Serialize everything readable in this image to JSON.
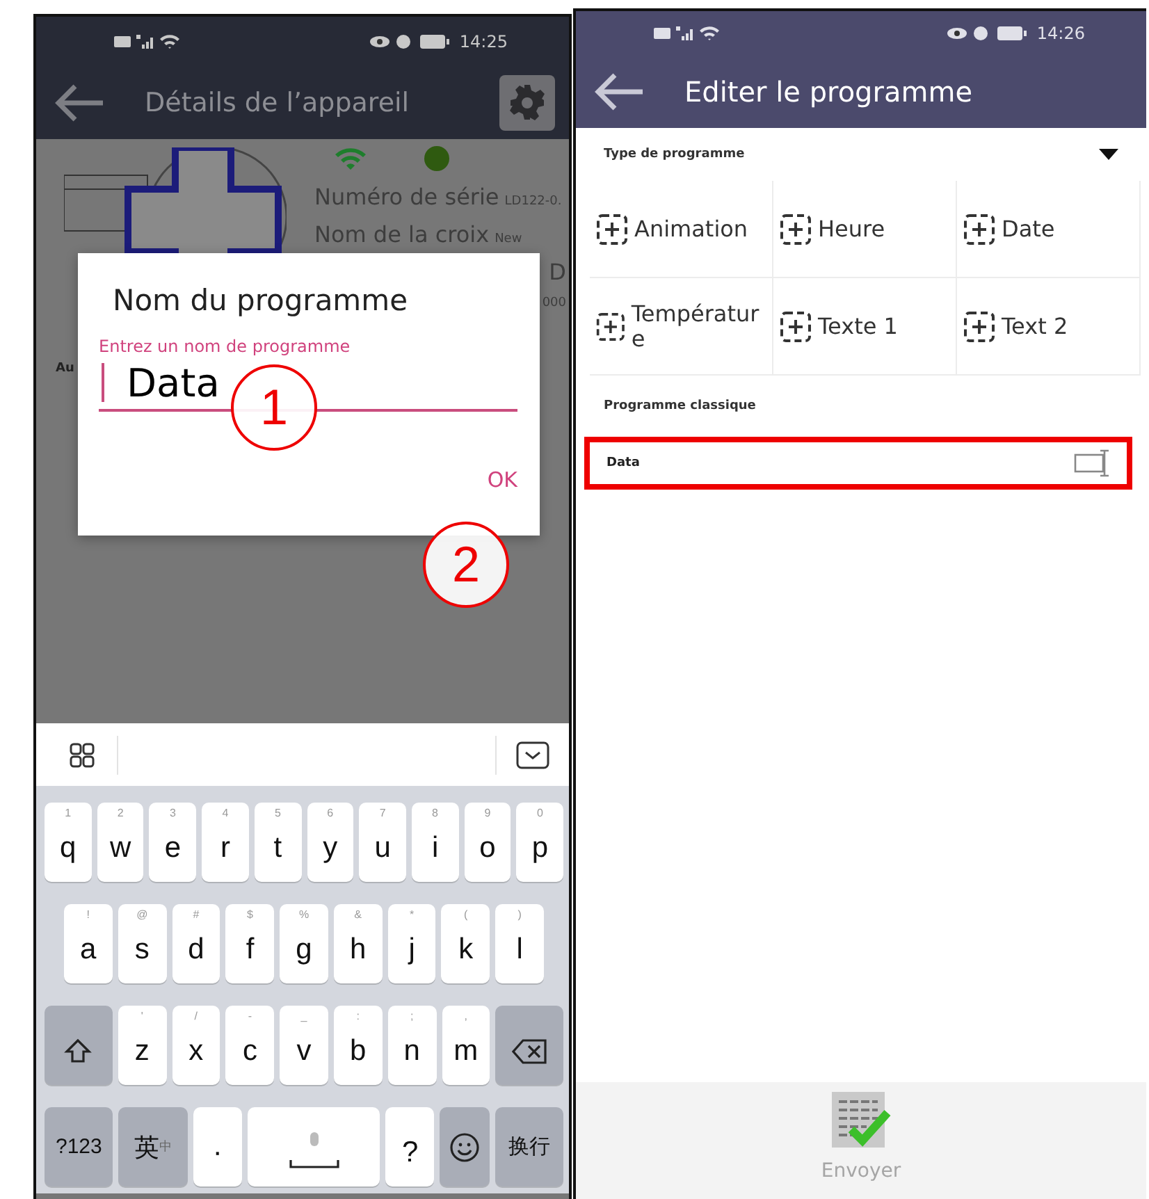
{
  "left_screen": {
    "status_bar": {
      "time": "14:25"
    },
    "header": {
      "title": "Détails de l’appareil"
    },
    "device": {
      "info": [
        {
          "label": "Numéro de série",
          "value": "LD122-0."
        },
        {
          "label": "Nom de la croix",
          "value": "New"
        },
        {
          "value": "D"
        },
        {
          "value": "000"
        }
      ],
      "side_label": "Au"
    },
    "dialog": {
      "title": "Nom du programme",
      "field": {
        "placeholder": "Entrez un nom de programme",
        "value": "Data"
      },
      "ok": "OK"
    },
    "annotations": [
      "1",
      "2"
    ],
    "keyboard": {
      "rows": [
        [
          {
            "kind": "letter",
            "label": "q",
            "hint": "1"
          },
          {
            "kind": "letter",
            "label": "w",
            "hint": "2"
          },
          {
            "kind": "letter",
            "label": "e",
            "hint": "3"
          },
          {
            "kind": "letter",
            "label": "r",
            "hint": "4"
          },
          {
            "kind": "letter",
            "label": "t",
            "hint": "5"
          },
          {
            "kind": "letter",
            "label": "y",
            "hint": "6"
          },
          {
            "kind": "letter",
            "label": "u",
            "hint": "7"
          },
          {
            "kind": "letter",
            "label": "i",
            "hint": "8"
          },
          {
            "kind": "letter",
            "label": "o",
            "hint": "9"
          },
          {
            "kind": "letter",
            "label": "p",
            "hint": "0"
          }
        ],
        [
          {
            "kind": "letter",
            "label": "a",
            "hint": "!"
          },
          {
            "kind": "letter",
            "label": "s",
            "hint": "@"
          },
          {
            "kind": "letter",
            "label": "d",
            "hint": "#"
          },
          {
            "kind": "letter",
            "label": "f",
            "hint": "$"
          },
          {
            "kind": "letter",
            "label": "g",
            "hint": "%"
          },
          {
            "kind": "letter",
            "label": "h",
            "hint": "&"
          },
          {
            "kind": "letter",
            "label": "j",
            "hint": "*"
          },
          {
            "kind": "letter",
            "label": "k",
            "hint": "("
          },
          {
            "kind": "letter",
            "label": "l",
            "hint": ")"
          }
        ],
        [
          {
            "kind": "shift"
          },
          {
            "kind": "letter",
            "label": "z",
            "hint": "'"
          },
          {
            "kind": "letter",
            "label": "x",
            "hint": "/"
          },
          {
            "kind": "letter",
            "label": "c",
            "hint": "-"
          },
          {
            "kind": "letter",
            "label": "v",
            "hint": "_"
          },
          {
            "kind": "letter",
            "label": "b",
            "hint": ":"
          },
          {
            "kind": "letter",
            "label": "n",
            "hint": ";"
          },
          {
            "kind": "letter",
            "label": "m",
            "hint": ","
          },
          {
            "kind": "backspace"
          }
        ]
      ],
      "bottom_row": [
        {
          "kind": "function",
          "label": "?123"
        },
        {
          "kind": "language",
          "label": "英",
          "hint": "中"
        },
        {
          "kind": "letter",
          "label": "·"
        },
        {
          "kind": "space"
        },
        {
          "kind": "letter",
          "label": "?"
        },
        {
          "kind": "emoji"
        },
        {
          "kind": "function",
          "label": "换行"
        }
      ]
    }
  },
  "right_screen": {
    "status_bar": {
      "time": "14:26"
    },
    "header": {
      "title": "Editer le programme"
    },
    "type_section": {
      "label": "Type de programme",
      "expanded": true
    },
    "types": [
      {
        "label": "Animation"
      },
      {
        "label": "Heure"
      },
      {
        "label": "Date"
      },
      {
        "label": "Températur e"
      },
      {
        "label": "Texte 1"
      },
      {
        "label": "Text 2"
      }
    ],
    "classic_section": {
      "label": "Programme classique"
    },
    "programs": [
      {
        "name": "Data",
        "highlighted": true
      }
    ],
    "send_button": {
      "label": "Envoyer"
    }
  }
}
